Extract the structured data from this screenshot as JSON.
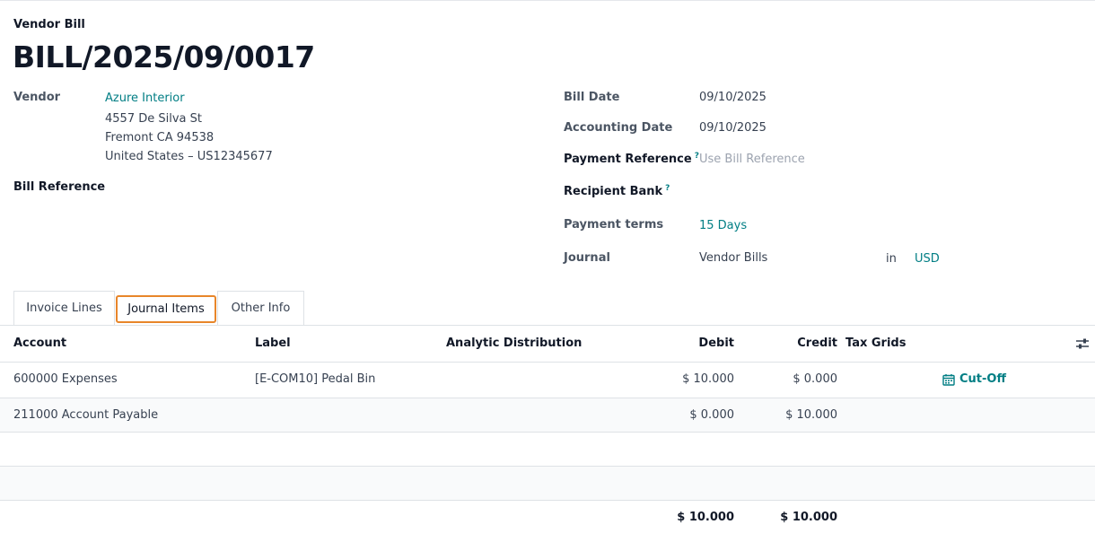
{
  "header": {
    "doc_type": "Vendor Bill",
    "bill_name": "BILL/2025/09/0017"
  },
  "left": {
    "vendor_label": "Vendor",
    "vendor_name": "Azure Interior",
    "address_line1": "4557 De Silva St",
    "address_line2": "Fremont CA 94538",
    "address_line3": "United States – US12345677",
    "bill_reference_label": "Bill Reference"
  },
  "right": {
    "bill_date_label": "Bill Date",
    "bill_date": "09/10/2025",
    "accounting_date_label": "Accounting Date",
    "accounting_date": "09/10/2025",
    "payment_reference_label": "Payment Reference",
    "payment_reference_placeholder": "Use Bill Reference",
    "recipient_bank_label": "Recipient Bank",
    "payment_terms_label": "Payment terms",
    "payment_terms": "15 Days",
    "journal_label": "Journal",
    "journal": "Vendor Bills",
    "in_label": "in",
    "currency": "USD",
    "help_mark": "?"
  },
  "tabs": {
    "invoice_lines": "Invoice Lines",
    "journal_items": "Journal Items",
    "other_info": "Other Info"
  },
  "table": {
    "columns": {
      "account": "Account",
      "label": "Label",
      "analytic": "Analytic Distribution",
      "debit": "Debit",
      "credit": "Credit",
      "tax_grids": "Tax Grids"
    },
    "rows": [
      {
        "account": "600000 Expenses",
        "label": "[E-COM10] Pedal Bin",
        "debit": "$ 10.000",
        "credit": "$ 0.000",
        "action": "Cut-Off"
      },
      {
        "account": "211000 Account Payable",
        "label": "",
        "debit": "$ 0.000",
        "credit": "$ 10.000",
        "action": ""
      }
    ],
    "totals": {
      "debit": "$ 10.000",
      "credit": "$ 10.000"
    }
  },
  "icons": {
    "cutoff": "calendar-icon",
    "settings": "sliders-icon"
  },
  "colors": {
    "accent": "#017e84",
    "active_tab_border": "#e8862a"
  }
}
